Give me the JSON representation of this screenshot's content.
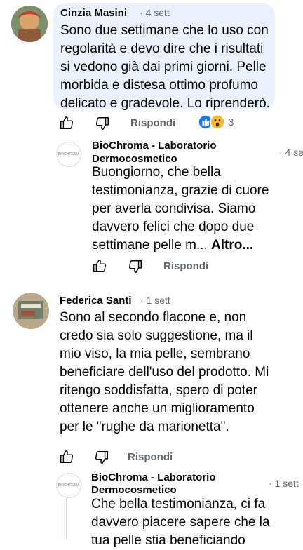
{
  "comments": [
    {
      "author": "Cinzia Masini",
      "time": "· 4 sett",
      "text": "Sono due settimane che lo uso con regolarità e devo dire che i risultati si vedono già dai primi giorni. Pelle morbida e distesa ottimo profumo delicato e gradevole. Lo riprenderò.",
      "reply_label": "Rispondi",
      "reaction_count": "3",
      "reply": {
        "author_line1": "BioChroma - Laboratorio",
        "author_line2": "Dermocosmetico",
        "time": "· 4 se",
        "text": "Buongiorno, che bella testimonianza, grazie di cuore per averla condivisa. Siamo davvero felici che dopo due settimane pelle m...",
        "more": "Altro...",
        "reply_label": "Rispondi",
        "avatar_text": "BIOCHROMA"
      }
    },
    {
      "author": "Federica Santi",
      "time": "· 1 sett",
      "text": "Sono al secondo flacone e, non credo sia solo suggestione, ma il mio viso, la mia pelle, sembrano beneficiare dell'uso del prodotto. Mi ritengo soddisfatta, spero di poter ottenere anche un miglioramento per le \"rughe da marionetta\".",
      "reply_label": "Rispondi",
      "reply": {
        "author_line1": "BioChroma - Laboratorio",
        "author_line2": "Dermocosmetico",
        "time": "· 1 sett",
        "text": "Che bella testimonianza, ci fa davvero piacere sapere che la tua pelle stia beneficiando",
        "avatar_text": "BIOCHROMA"
      }
    }
  ],
  "colors": {
    "bubble": "#eaf1fd",
    "muted": "#65676b",
    "like_blue": "#1877f2",
    "wow_yellow": "#f7b928"
  },
  "icons": [
    "like-icon",
    "dislike-icon",
    "like-reaction-icon",
    "wow-reaction-icon"
  ]
}
